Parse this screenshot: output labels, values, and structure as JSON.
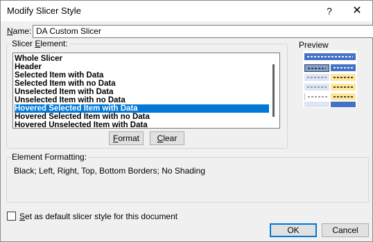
{
  "window": {
    "title": "Modify Slicer Style",
    "help_label": "?",
    "close_label": "✕"
  },
  "name": {
    "label": "Name:",
    "value": "DA Custom Slicer"
  },
  "slicer_element": {
    "label": "Slicer Element:",
    "items": [
      {
        "label": "Whole Slicer",
        "selected": false
      },
      {
        "label": "Header",
        "selected": false
      },
      {
        "label": "Selected Item with Data",
        "selected": false
      },
      {
        "label": "Selected Item with no Data",
        "selected": false
      },
      {
        "label": "Unselected Item with Data",
        "selected": false
      },
      {
        "label": "Unselected Item with no Data",
        "selected": false
      },
      {
        "label": "Hovered Selected Item with Data",
        "selected": true
      },
      {
        "label": "Hovered Selected Item with no Data",
        "selected": false
      },
      {
        "label": "Hovered Unselected Item with Data",
        "selected": false
      }
    ],
    "format_button": "Format",
    "clear_button": "Clear"
  },
  "preview": {
    "label": "Preview",
    "colors": {
      "header": "#4472c4",
      "selected": "#7f9fd6",
      "hovered": "#ffe699",
      "unselected": "#dde6f5"
    }
  },
  "element_formatting": {
    "label": "Element Formatting:",
    "description": "Black; Left, Right, Top, Bottom Borders; No Shading"
  },
  "default_checkbox": {
    "label": "Set as default slicer style for this document",
    "checked": false
  },
  "buttons": {
    "ok": "OK",
    "cancel": "Cancel"
  },
  "accent_color": "#0078d7"
}
